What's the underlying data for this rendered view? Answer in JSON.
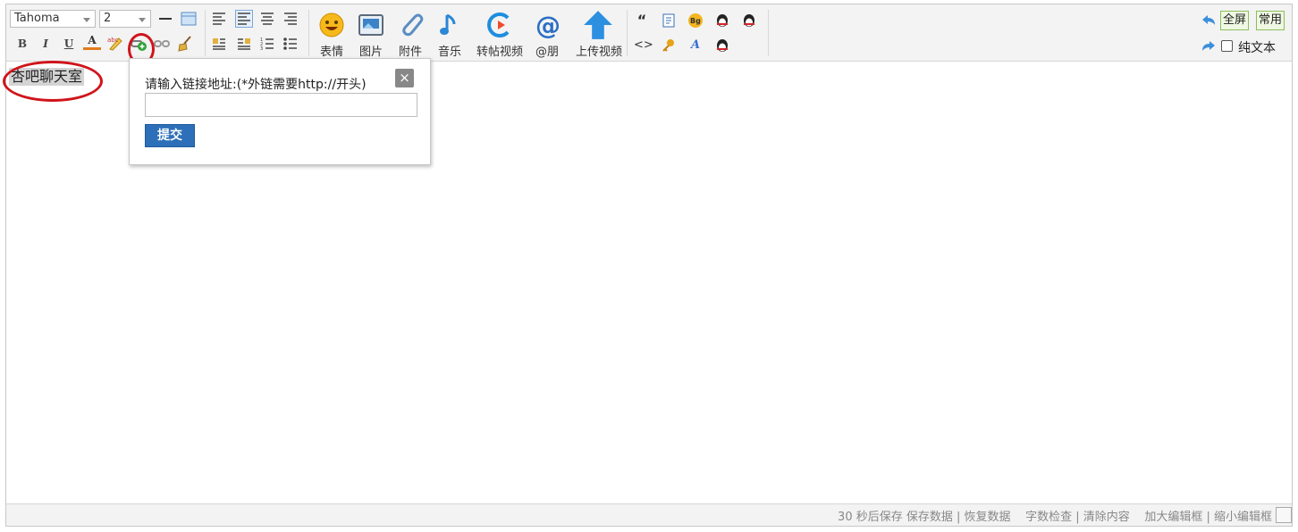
{
  "toolbar": {
    "font_family": "Tahoma",
    "font_size": "2",
    "format_buttons": [
      "B",
      "I",
      "U",
      "A"
    ],
    "big_buttons": [
      {
        "label": "表情",
        "icon": "smiley-icon"
      },
      {
        "label": "图片",
        "icon": "image-icon"
      },
      {
        "label": "附件",
        "icon": "paperclip-icon"
      },
      {
        "label": "音乐",
        "icon": "music-note-icon"
      },
      {
        "label": "转帖视频",
        "icon": "video-play-icon"
      },
      {
        "label": "@朋",
        "icon": "at-icon"
      },
      {
        "label": "上传视频",
        "icon": "upload-arrow-icon"
      }
    ],
    "quote_glyph": "“",
    "code_glyph": "<>",
    "bg_badge": "Bg",
    "font_a_glyph": "A",
    "fullscreen_label": "全屏",
    "common_label": "常用",
    "plaintext_label": "纯文本"
  },
  "content": {
    "selected_text": "杏吧聊天室"
  },
  "link_popup": {
    "title": "请输入链接地址:(*外链需要http://开头)",
    "close_glyph": "×",
    "url_value": "",
    "submit_label": "提交"
  },
  "statusbar": {
    "autosave": "30 秒后保存",
    "save_data": "保存数据",
    "divider": " | ",
    "restore_data": "恢复数据",
    "word_check": "字数检查",
    "clear_content": "清除内容",
    "enlarge": "加大编辑框",
    "shrink": "缩小编辑框"
  },
  "colors": {
    "annotation_red": "#d0141b",
    "submit_blue": "#2d6fb8",
    "toolbar_bg": "#f3f3f3"
  }
}
